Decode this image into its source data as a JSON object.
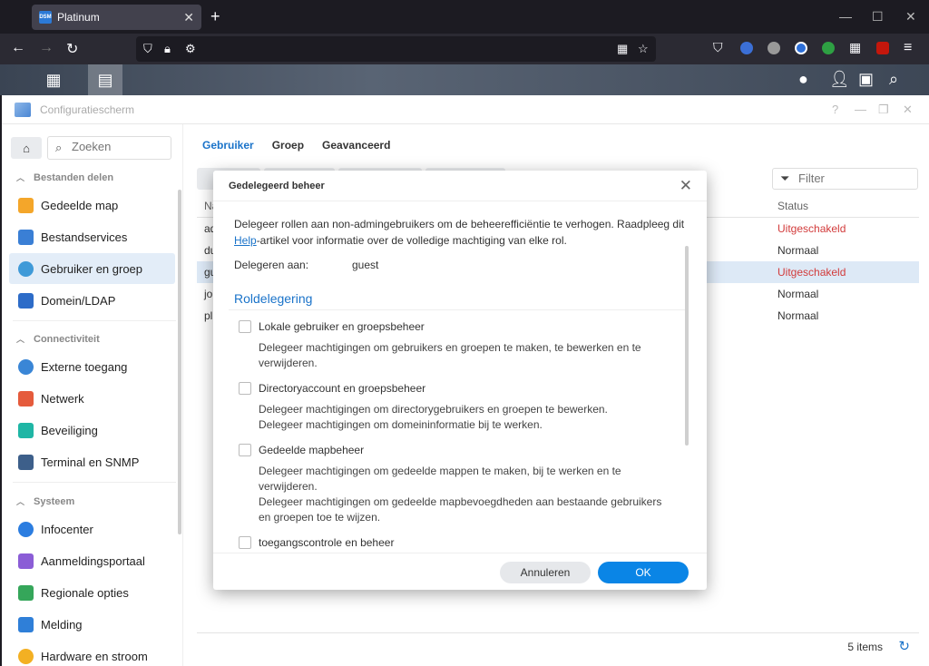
{
  "browser": {
    "tab_title": "Platinum",
    "favicon_text": "DSM"
  },
  "window": {
    "title": "Configuratiescherm"
  },
  "sidebar": {
    "search_placeholder": "Zoeken",
    "sections": [
      {
        "label": "Bestanden delen"
      },
      {
        "label": "Connectiviteit"
      },
      {
        "label": "Systeem"
      }
    ],
    "items": [
      {
        "label": "Gedeelde map",
        "color": "#f4a62a"
      },
      {
        "label": "Bestandservices",
        "color": "#3a7fd5"
      },
      {
        "label": "Gebruiker en groep",
        "color": "#3f9ad8"
      },
      {
        "label": "Domein/LDAP",
        "color": "#2d6cc8"
      },
      {
        "label": "Externe toegang",
        "color": "#3a86d6"
      },
      {
        "label": "Netwerk",
        "color": "#e55b3c"
      },
      {
        "label": "Beveiliging",
        "color": "#1fb6a5"
      },
      {
        "label": "Terminal en SNMP",
        "color": "#3d5f8a"
      },
      {
        "label": "Infocenter",
        "color": "#2b7de0"
      },
      {
        "label": "Aanmeldingsportaal",
        "color": "#8b5dd6"
      },
      {
        "label": "Regionale opties",
        "color": "#35a65a"
      },
      {
        "label": "Melding",
        "color": "#2f7fd8"
      },
      {
        "label": "Hardware en stroom",
        "color": "#f3b023"
      }
    ]
  },
  "main": {
    "tabs": [
      "Gebruiker",
      "Groep",
      "Geavanceerd"
    ],
    "filter_placeholder": "Filter",
    "columns": {
      "name": "Na",
      "status": "Status"
    },
    "rows": [
      {
        "name": "ad",
        "status": "Uitgeschakeld"
      },
      {
        "name": "du",
        "status": "Normaal"
      },
      {
        "name": "gu",
        "status": "Uitgeschakeld"
      },
      {
        "name": "jo",
        "status": "Normaal"
      },
      {
        "name": "pl",
        "status": "Normaal"
      }
    ],
    "item_count": "5 items"
  },
  "modal": {
    "title": "Gedelegeerd beheer",
    "intro_before_link": "Delegeer rollen aan non-admingebruikers om de beheerefficiëntie te verhogen. Raadpleeg dit ",
    "intro_link": "Help",
    "intro_after_link": "-artikel voor informatie over de volledige machtiging van elke rol.",
    "delegate_to_label": "Delegeren aan:",
    "delegate_to_value": "guest",
    "section_title": "Roldelegering",
    "roles": [
      {
        "label": "Lokale gebruiker en groepsbeheer",
        "desc": [
          "Delegeer machtigingen om gebruikers en groepen te maken, te bewerken en te verwijderen."
        ]
      },
      {
        "label": "Directoryaccount en groepsbeheer",
        "desc": [
          "Delegeer machtigingen om directorygebruikers en groepen te bewerken.",
          "Delegeer machtigingen om domeininformatie bij te werken."
        ]
      },
      {
        "label": "Gedeelde mapbeheer",
        "desc": [
          "Delegeer machtigingen om gedeelde mappen te maken, bij te werken en te verwijderen.",
          "Delegeer machtigingen om gedeelde mapbevoegdheden aan bestaande gebruikers en groepen toe te wijzen."
        ]
      },
      {
        "label": "toegangscontrole en beheer",
        "desc": []
      }
    ],
    "cancel_label": "Annuleren",
    "ok_label": "OK"
  }
}
